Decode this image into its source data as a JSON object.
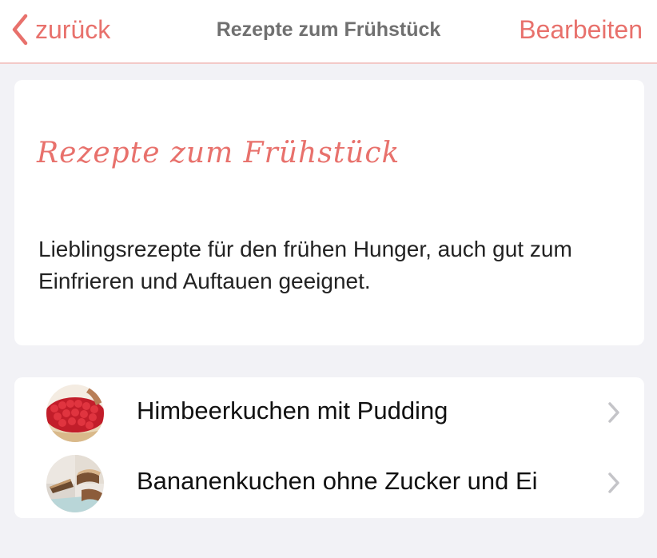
{
  "nav": {
    "back_label": "zurück",
    "title": "Rezepte zum Frühstück",
    "edit_label": "Bearbeiten",
    "back_icon": "chevron-left-icon"
  },
  "info": {
    "title": "Rezepte zum Frühstück",
    "description": "Lieblingsrezepte für den frühen Hunger, auch gut zum Einfrieren und Auftauen geeignet."
  },
  "recipes": [
    {
      "label": "Himbeerkuchen mit Pudding",
      "thumb_icon": "raspberry-cake-thumbnail"
    },
    {
      "label": "Bananenkuchen ohne Zucker und Ei",
      "thumb_icon": "banana-cake-thumbnail"
    }
  ],
  "colors": {
    "accent": "#e8716c",
    "background": "#f2f2f6",
    "nav_title": "#707070",
    "separator": "#f3c9c7"
  }
}
